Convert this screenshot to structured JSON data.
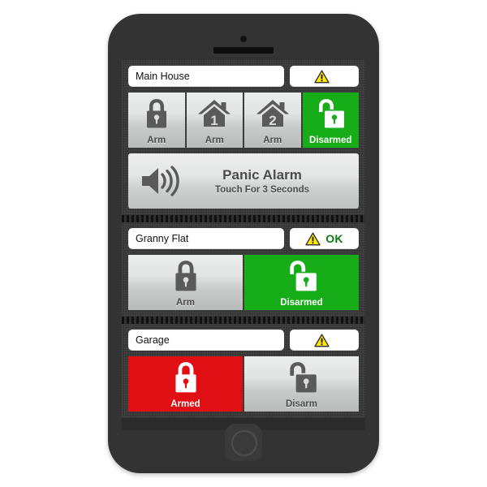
{
  "device": {
    "camera": "camera-dot",
    "earpiece": "earpiece-speaker",
    "home_button": "home-button"
  },
  "sections": [
    {
      "id": "main-house",
      "name_value": "Main House",
      "status": {
        "icon": "warning-triangle-icon",
        "text": ""
      },
      "buttons": [
        {
          "label": "Arm",
          "icon": "padlock-closed-icon",
          "state": "grey"
        },
        {
          "label": "Arm",
          "icon": "house-1-icon",
          "state": "grey"
        },
        {
          "label": "Arm",
          "icon": "house-2-icon",
          "state": "grey"
        },
        {
          "label": "Disarmed",
          "icon": "padlock-open-icon",
          "state": "green"
        }
      ],
      "panic": {
        "icon": "speaker-icon",
        "title": "Panic Alarm",
        "subtitle": "Touch For 3 Seconds"
      }
    },
    {
      "id": "granny-flat",
      "name_value": "Granny Flat",
      "status": {
        "icon": "warning-triangle-icon",
        "text": "OK"
      },
      "buttons": [
        {
          "label": "Arm",
          "icon": "padlock-closed-icon",
          "state": "grey"
        },
        {
          "label": "Disarmed",
          "icon": "padlock-open-icon",
          "state": "green"
        }
      ]
    },
    {
      "id": "garage",
      "name_value": "Garage",
      "status": {
        "icon": "warning-triangle-icon",
        "text": ""
      },
      "buttons": [
        {
          "label": "Armed",
          "icon": "padlock-closed-icon",
          "state": "red"
        },
        {
          "label": "Disarm",
          "icon": "padlock-open-icon",
          "state": "grey"
        }
      ]
    }
  ],
  "colors": {
    "green": "#17ad19",
    "red": "#e00f13",
    "ok_text": "#0a7a12",
    "warning_yellow": "#ffe800",
    "icon_grey": "#5a5a5a",
    "phone_body": "#333333",
    "screen_bg": "#2b2b2b"
  }
}
